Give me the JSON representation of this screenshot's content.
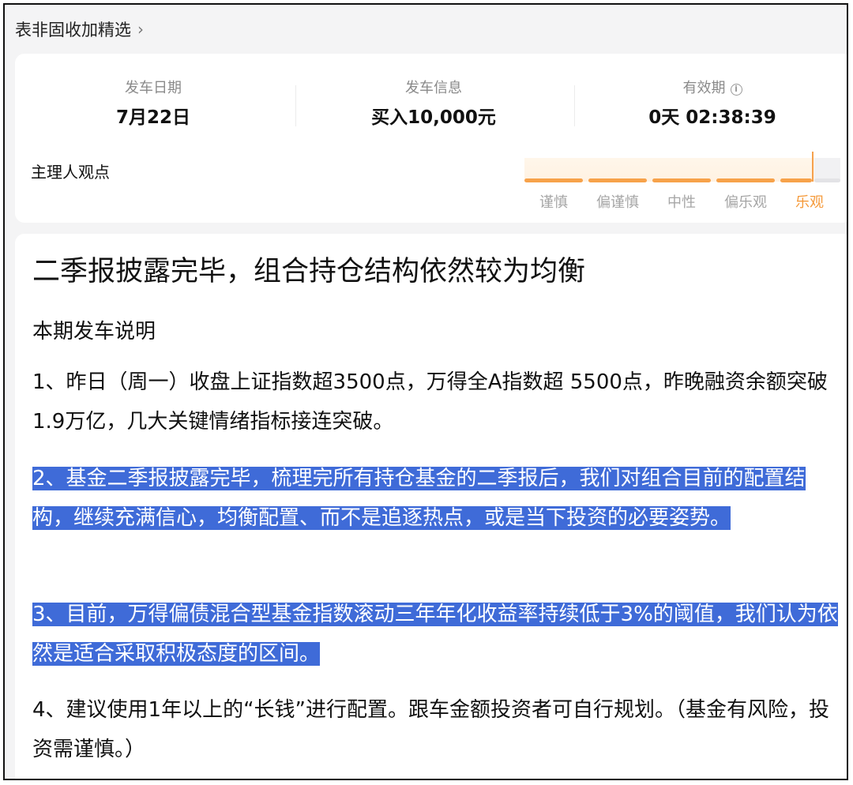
{
  "breadcrumb": {
    "label": "表非固收加精选",
    "chevron": "›"
  },
  "stats": [
    {
      "label": "发车日期",
      "value": "7月22日"
    },
    {
      "label": "发车信息",
      "value": "买入10,000元"
    },
    {
      "label": "有效期",
      "value": "0天 02:38:39",
      "info_icon": "info-circle-icon",
      "info_glyph": "i"
    }
  ],
  "opinion": {
    "label": "主理人观点",
    "levels": [
      "谨慎",
      "偏谨慎",
      "中性",
      "偏乐观",
      "乐观"
    ],
    "selected": "乐观",
    "accent_color": "#f59a3b"
  },
  "article": {
    "title": "二季报披露完毕，组合持仓结构依然较为均衡",
    "section": "本期发车说明",
    "paragraphs": [
      "1、昨日（周一）收盘上证指数超3500点，万得全A指数超 5500点，昨晚融资余额突破1.9万亿，几大关键情绪指标接连突破。",
      "2、基金二季报披露完毕，梳理完所有持仓基金的二季报后，我们对组合目前的配置结构，继续充满信心，均衡配置、而不是追逐热点，或是当下投资的必要姿势。",
      "3、目前，万得偏债混合型基金指数滚动三年年化收益率持续低于3%的阈值，我们认为依然是适合采取积极态度的区间。",
      "4、建议使用1年以上的“长钱”进行配置。跟车金额投资者可自行规划。（基金有风险，投资需谨慎。）"
    ],
    "highlight_color": "#3f6bd8"
  }
}
